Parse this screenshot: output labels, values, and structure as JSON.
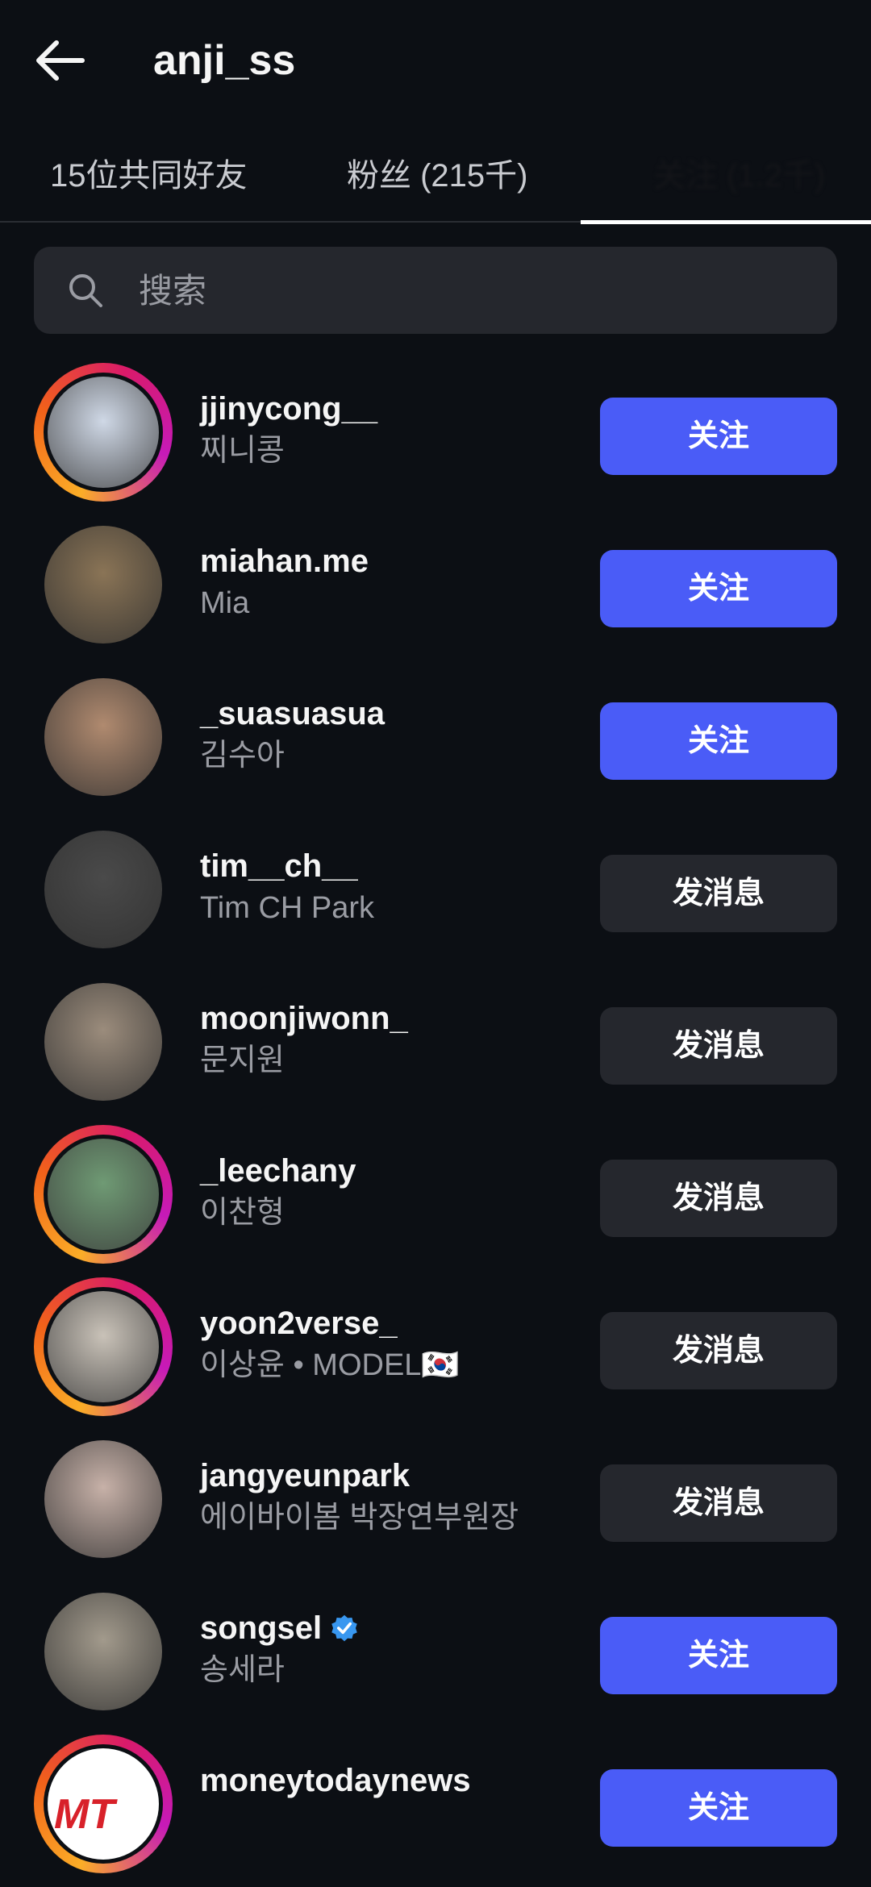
{
  "header": {
    "title": "anji_ss",
    "back_icon": "arrow-left-icon"
  },
  "tabs": [
    {
      "label": "15位共同好友"
    },
    {
      "label": "粉丝 (215千)"
    },
    {
      "label": "关注 (1.2千)",
      "active": true
    }
  ],
  "search": {
    "placeholder": "搜索",
    "icon": "search-icon"
  },
  "users": [
    {
      "username": "jjinycong__",
      "subtitle": "찌니콩",
      "button": "关注",
      "button_type": "follow",
      "story_ring": true,
      "avatar_color": "#cfd8e6"
    },
    {
      "username": "miahan.me",
      "subtitle": "Mia",
      "button": "关注",
      "button_type": "follow",
      "story_ring": false,
      "avatar_color": "#8a7456"
    },
    {
      "username": "_suasuasua",
      "subtitle": "김수아",
      "button": "关注",
      "button_type": "follow",
      "story_ring": false,
      "avatar_color": "#b08a6f"
    },
    {
      "username": "tim__ch__",
      "subtitle": "Tim CH Park",
      "button": "发消息",
      "button_type": "message",
      "story_ring": false,
      "avatar_color": "#4a4a4a"
    },
    {
      "username": "moonjiwonn_",
      "subtitle": "문지원",
      "button": "发消息",
      "button_type": "message",
      "story_ring": false,
      "avatar_color": "#9b8c7c"
    },
    {
      "username": "_leechany",
      "subtitle": "이찬형",
      "button": "发消息",
      "button_type": "message",
      "story_ring": true,
      "avatar_color": "#6f9a74"
    },
    {
      "username": "yoon2verse_",
      "subtitle": "이상윤 • MODEL🇰🇷",
      "button": "发消息",
      "button_type": "message",
      "story_ring": true,
      "avatar_color": "#c9c2b8"
    },
    {
      "username": "jangyeunpark",
      "subtitle": "에이바이봄 박장연부원장",
      "button": "发消息",
      "button_type": "message",
      "story_ring": false,
      "avatar_color": "#c7b1a8"
    },
    {
      "username": "songsel",
      "subtitle": "송세라",
      "button": "关注",
      "button_type": "follow",
      "story_ring": false,
      "verified": true,
      "avatar_color": "#a29a8c"
    },
    {
      "username": "moneytodaynews",
      "subtitle": "",
      "button": "关注",
      "button_type": "follow",
      "story_ring": true,
      "avatar_color": "#ffffff",
      "avatar_text": "MT"
    }
  ],
  "colors": {
    "background": "#0c0f14",
    "follow_button": "#4a5cf7",
    "message_button": "#25272d",
    "verified": "#3897f0"
  }
}
